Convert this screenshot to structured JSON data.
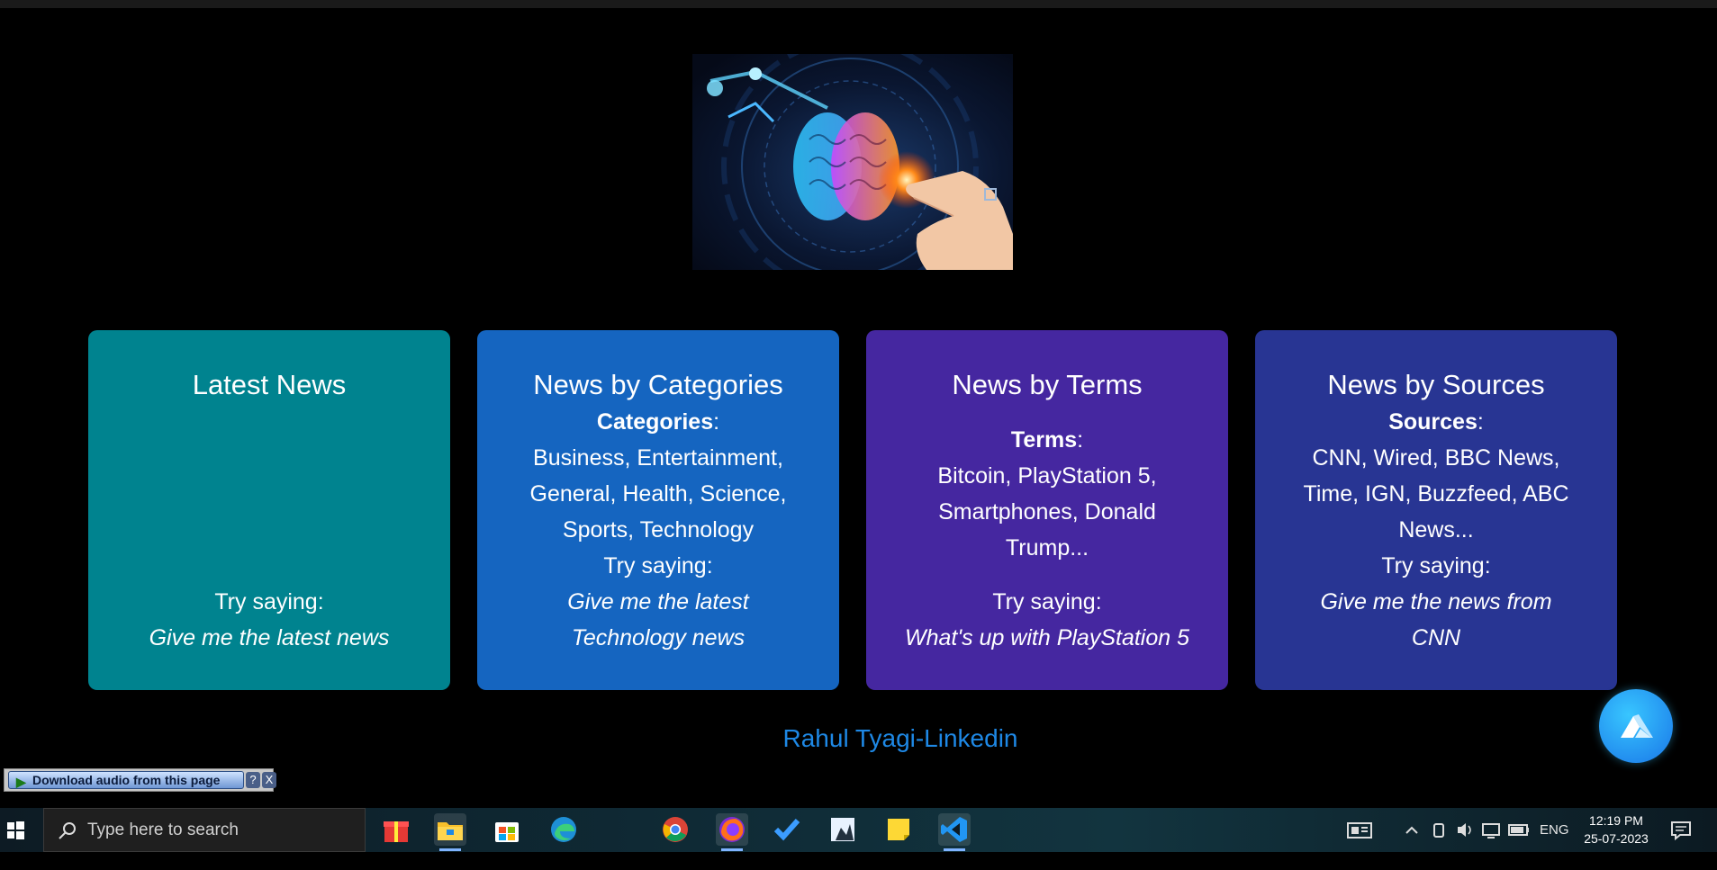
{
  "hero_image": {
    "alt": "AI brain illustration"
  },
  "cards": [
    {
      "title": "Latest News",
      "color": "#00838f",
      "try_label": "Try saying:",
      "example": "Give me the latest news"
    },
    {
      "title": "News by Categories",
      "color": "#1565c0",
      "list_label": "Categories",
      "list_text": "Business, Entertainment, General, Health, Science, Sports, Technology",
      "try_label": "Try saying:",
      "example": "Give me the latest Technology news"
    },
    {
      "title": "News by Terms",
      "color": "#4527a0",
      "list_label": "Terms",
      "list_text": "Bitcoin, PlayStation 5, Smartphones, Donald Trump...",
      "try_label": "Try saying:",
      "example": "What's up with PlayStation 5"
    },
    {
      "title": "News by Sources",
      "color": "#283593",
      "list_label": "Sources",
      "list_text": "CNN, Wired, BBC News, Time, IGN, Buzzfeed, ABC News...",
      "try_label": "Try saying:",
      "example": "Give me the news from CNN"
    }
  ],
  "footer": {
    "link_text": "Rahul Tyagi-Linkedin",
    "link_color": "#1e88e5"
  },
  "download_bar": {
    "button_label": "Download audio from this page",
    "help": "?",
    "close": "X"
  },
  "taskbar": {
    "search_placeholder": "Type here to search",
    "apps": [
      "gift-icon",
      "file-explorer-icon",
      "store-icon",
      "edge-icon",
      "chrome-icon",
      "firefox-icon",
      "todo-icon",
      "app-icon",
      "sticky-notes-icon",
      "vscode-icon"
    ],
    "language": "ENG",
    "time": "12:19 PM",
    "date": "25-07-2023"
  }
}
